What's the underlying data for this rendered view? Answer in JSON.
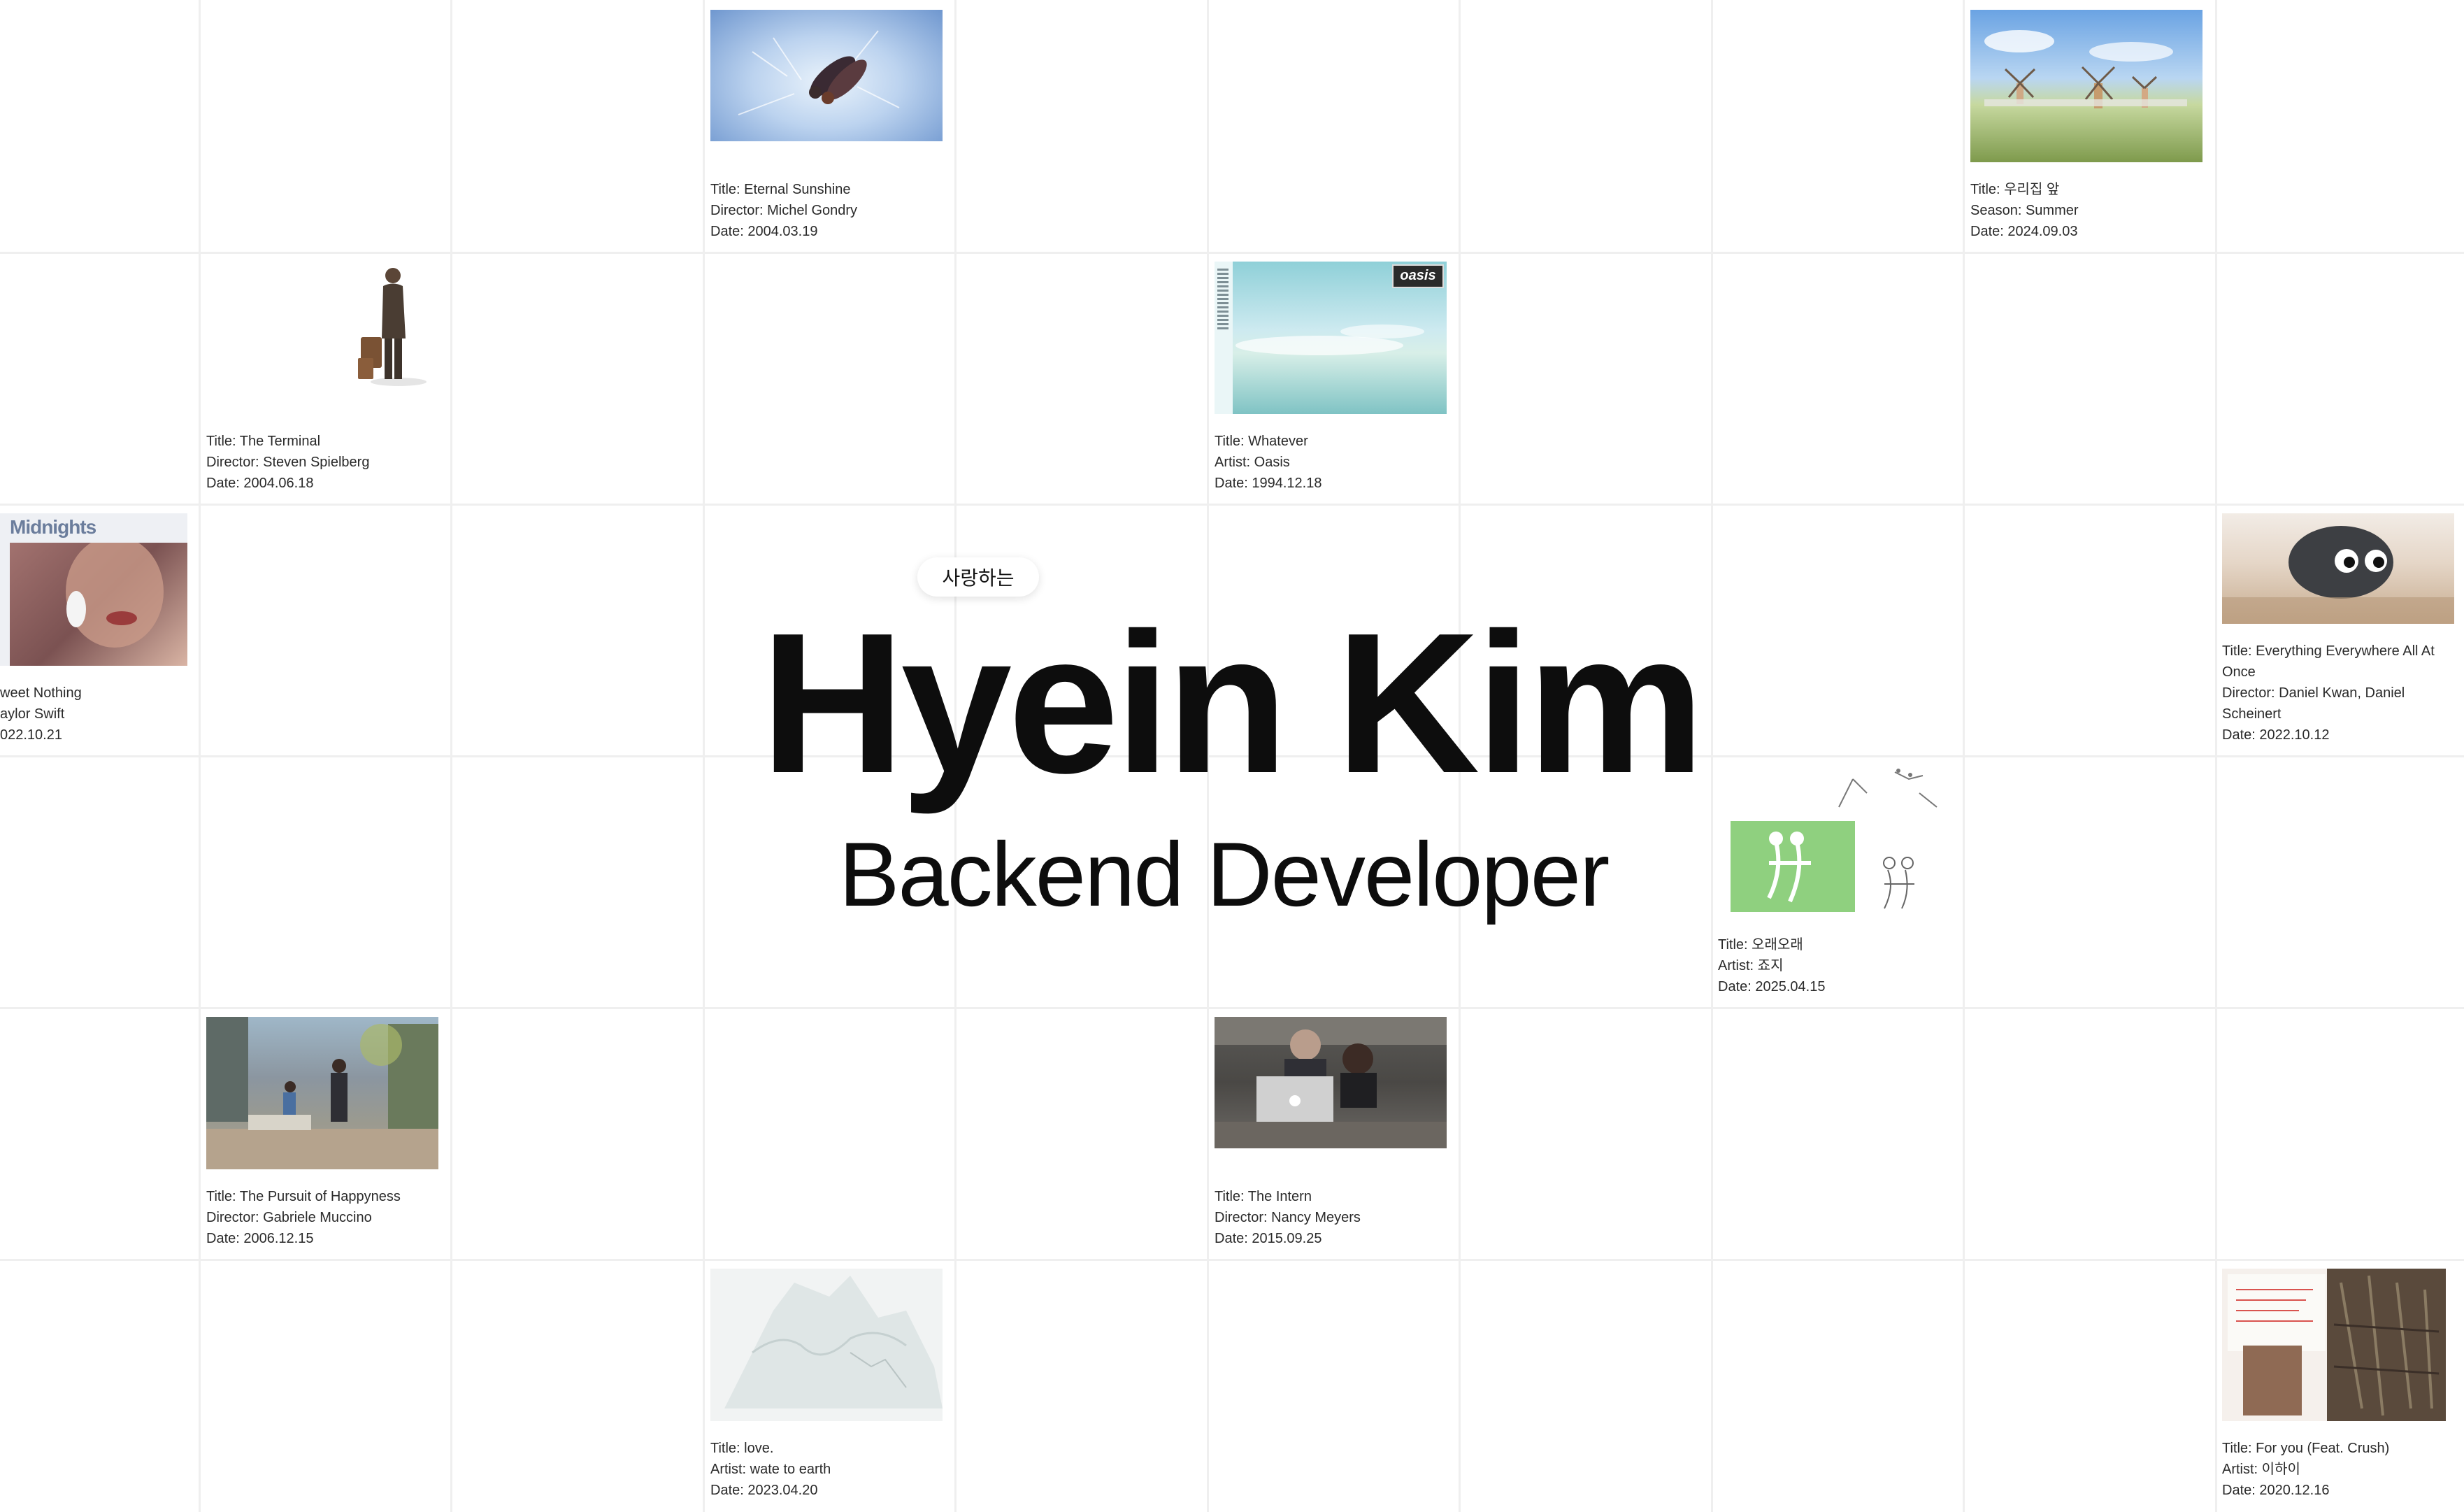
{
  "hero": {
    "tag": "사랑하는",
    "name": "Hyein Kim",
    "role": "Backend Developer"
  },
  "cards": {
    "eternal": {
      "image": "couple-lying-on-ice",
      "lines": [
        "Title: Eternal Sunshine",
        "Director: Michel Gondry",
        "Date: 2004.03.19"
      ]
    },
    "woorijip": {
      "image": "windmills-in-field",
      "lines": [
        "Title: 우리집 앞",
        "Season: Summer",
        "Date: 2024.09.03"
      ]
    },
    "terminal": {
      "image": "man-with-suitcase",
      "lines": [
        "Title: The Terminal",
        "Director: Steven Spielberg",
        "Date: 2004.06.18"
      ]
    },
    "whatever": {
      "image": "oasis-sky-cover",
      "badge": "oasis",
      "lines": [
        "Title: Whatever",
        "Artist: Oasis",
        "Date: 1994.12.18"
      ]
    },
    "midnights": {
      "image": "midnights-cover",
      "cover_text": "Midnights",
      "lines": [
        "weet Nothing",
        "aylor Swift",
        "022.10.21"
      ]
    },
    "everything": {
      "image": "rock-with-googly-eyes",
      "lines": [
        "Title: Everything Everywhere All At Once",
        "Director: Daniel Kwan, Daniel Scheinert",
        "Date: 2022.10.12"
      ]
    },
    "orae": {
      "image": "green-sketch-illustration",
      "lines": [
        "Title: 오래오래",
        "Artist: 죠지",
        "Date: 2025.04.15"
      ]
    },
    "pursuit": {
      "image": "father-son-street",
      "lines": [
        "Title: The Pursuit of Happyness",
        "Director: Gabriele Muccino",
        "Date: 2006.12.15"
      ]
    },
    "intern": {
      "image": "office-laptop-scene",
      "lines": [
        "Title: The Intern",
        "Director: Nancy Meyers",
        "Date: 2015.09.25"
      ]
    },
    "love": {
      "image": "faded-sketch-cover",
      "lines": [
        "Title: love.",
        "Artist: wate to earth",
        "Date: 2023.04.20"
      ]
    },
    "foryou": {
      "image": "collage-cover",
      "lines": [
        "Title: For you (Feat. Crush)",
        "Artist: 이하이",
        "Date: 2020.12.16"
      ]
    }
  }
}
